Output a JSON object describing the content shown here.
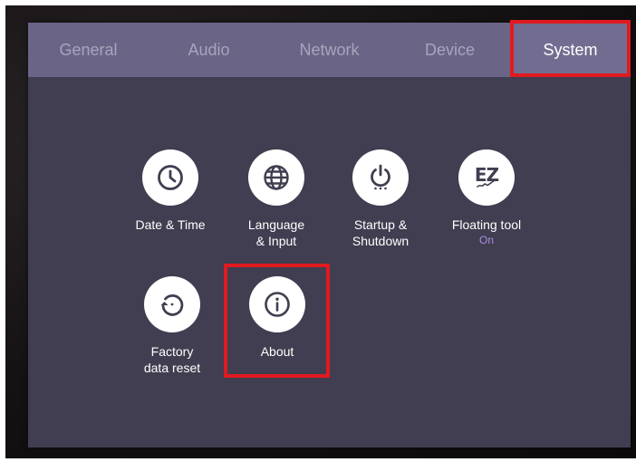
{
  "tabs": [
    {
      "label": "General",
      "active": false
    },
    {
      "label": "Audio",
      "active": false
    },
    {
      "label": "Network",
      "active": false
    },
    {
      "label": "Device",
      "active": false
    },
    {
      "label": "System",
      "active": true
    }
  ],
  "items": [
    {
      "label": "Date & Time",
      "icon": "clock-icon"
    },
    {
      "label": "Language\n& Input",
      "icon": "globe-icon"
    },
    {
      "label": "Startup &\nShutdown",
      "icon": "power-icon"
    },
    {
      "label": "Floating tool",
      "icon": "ez-write-icon",
      "icon_text": "EZ",
      "status": "On"
    },
    {
      "label": "Factory\ndata reset",
      "icon": "reset-icon"
    },
    {
      "label": "About",
      "icon": "info-icon"
    }
  ],
  "colors": {
    "panel": "#403e50",
    "tabbar": "#6a6586",
    "active_tab": "#726d90",
    "highlight": "#e01a20",
    "status_on": "#a98ee6"
  }
}
